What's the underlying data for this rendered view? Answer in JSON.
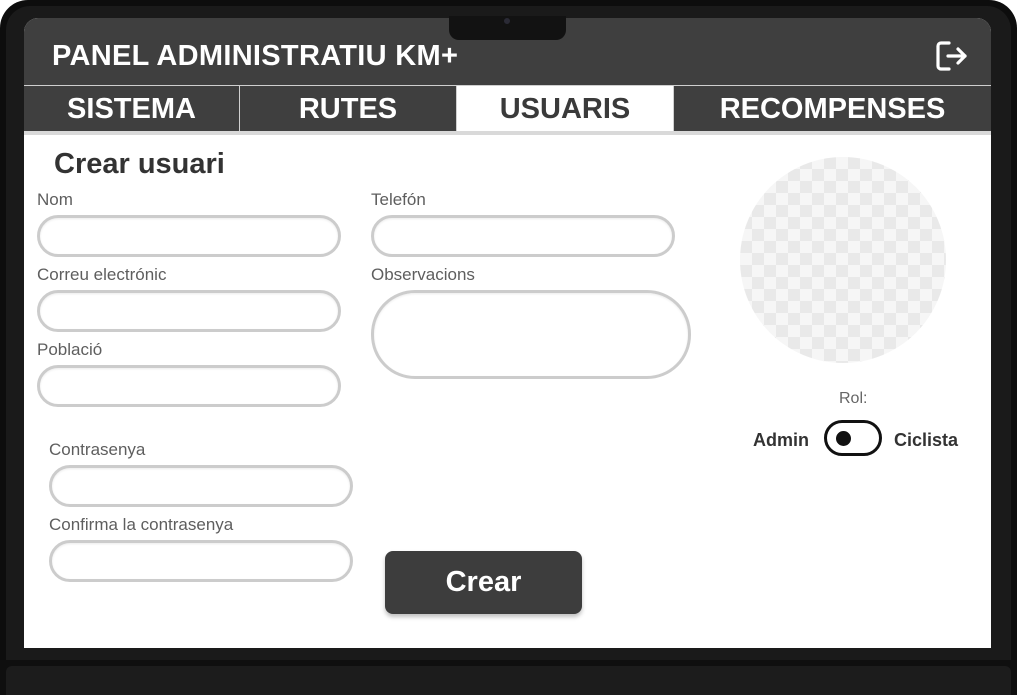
{
  "header": {
    "title": "PANEL ADMINISTRATIU KM+",
    "logout_icon": "logout-icon"
  },
  "tabs": [
    {
      "label": "SISTEMA",
      "active": false
    },
    {
      "label": "RUTES",
      "active": false
    },
    {
      "label": "USUARIS",
      "active": true
    },
    {
      "label": "RECOMPENSES",
      "active": false
    }
  ],
  "form": {
    "title": "Crear usuari",
    "fields": {
      "nom": {
        "label": "Nom",
        "value": "",
        "placeholder": ""
      },
      "telefon": {
        "label": "Telefón",
        "value": "",
        "placeholder": ""
      },
      "correu": {
        "label": "Correu electrónic",
        "value": "",
        "placeholder": ""
      },
      "observacions": {
        "label": "Observacions",
        "value": "",
        "placeholder": ""
      },
      "poblacio": {
        "label": "Població",
        "value": "",
        "placeholder": ""
      },
      "contrasenya": {
        "label": "Contrasenya",
        "value": "",
        "placeholder": ""
      },
      "confirma": {
        "label": "Confirma la contrasenya",
        "value": "",
        "placeholder": ""
      }
    },
    "role": {
      "label": "Rol:",
      "left_option": "Admin",
      "right_option": "Ciclista",
      "selected": "Admin"
    },
    "submit_label": "Crear"
  },
  "colors": {
    "header_bg": "#3f3f3f",
    "active_tab_bg": "#ffffff",
    "button_bg": "#3d3d3d"
  }
}
